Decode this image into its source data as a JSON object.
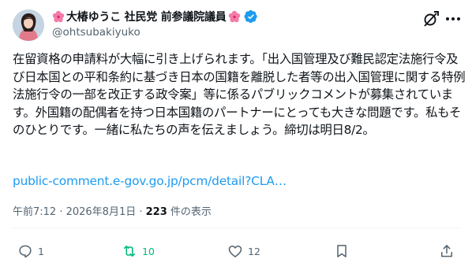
{
  "author": {
    "display_name": "大椿ゆうこ 社民党 前参議院議員",
    "handle": "@ohtsubakiyuko",
    "verified": true,
    "flower_icon": "hibiscus-emoji"
  },
  "tweet": {
    "text": "在留資格の申請料が大幅に引き上げられます。「出入国管理及び難民認定法施行令及び日本国との平和条約に基づき日本の国籍を離脱した者等の出入国管理に関する特例法施行令の一部を改正する政令案」等に係るパブリックコメントが募集されています。外国籍の配偶者を持つ日本国籍のパートナーにとっても大きな問題です。私もそのひとりです。一緒に私たちの声を伝えましょう。締切は明日8/2。",
    "link": "public-comment.e-gov.go.jp/pcm/detail?CLA…"
  },
  "meta": {
    "timestamp": "午前7:12 · 2026年8月1日 · ",
    "views": "223",
    "views_label": " 件の表示"
  },
  "actions": {
    "reply_count": "1",
    "repost_count": "10",
    "like_count": "12"
  },
  "colors": {
    "link": "#1d9bf0",
    "repost_active": "#00ba7c",
    "secondary_text": "#536471",
    "verified_badge": "#1d9bf0"
  }
}
